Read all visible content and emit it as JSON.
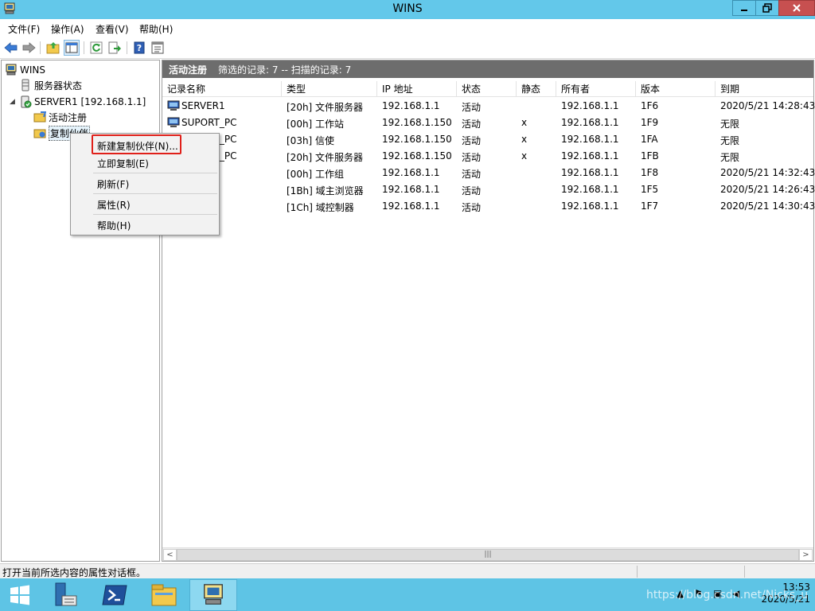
{
  "window": {
    "title": "WINS"
  },
  "menu": [
    "文件(F)",
    "操作(A)",
    "查看(V)",
    "帮助(H)"
  ],
  "tree": {
    "root": "WINS",
    "server_status": "服务器状态",
    "server": "SERVER1 [192.168.1.1]",
    "active_registrations": "活动注册",
    "replication_partners": "复制伙伴"
  },
  "pane_header": {
    "title": "活动注册",
    "summary": "筛选的记录: 7 -- 扫描的记录: 7"
  },
  "table": {
    "columns": [
      "记录名称",
      "类型",
      "IP 地址",
      "状态",
      "静态",
      "所有者",
      "版本",
      "到期"
    ],
    "rows": [
      [
        "SERVER1",
        "[20h] 文件服务器",
        "192.168.1.1",
        "活动",
        "",
        "192.168.1.1",
        "1F6",
        "2020/5/21 14:28:43"
      ],
      [
        "SUPORT_PC",
        "[00h] 工作站",
        "192.168.1.150",
        "活动",
        "x",
        "192.168.1.1",
        "1F9",
        "无限"
      ],
      [
        "SUPORT_PC",
        "[03h] 信使",
        "192.168.1.150",
        "活动",
        "x",
        "192.168.1.1",
        "1FA",
        "无限"
      ],
      [
        "SUPORT_PC",
        "[20h] 文件服务器",
        "192.168.1.150",
        "活动",
        "x",
        "192.168.1.1",
        "1FB",
        "无限"
      ],
      [
        "",
        "[00h] 工作组",
        "192.168.1.1",
        "活动",
        "",
        "192.168.1.1",
        "1F8",
        "2020/5/21 14:32:43"
      ],
      [
        "",
        "[1Bh] 域主浏览器",
        "192.168.1.1",
        "活动",
        "",
        "192.168.1.1",
        "1F5",
        "2020/5/21 14:26:43"
      ],
      [
        "",
        "[1Ch] 域控制器",
        "192.168.1.1",
        "活动",
        "",
        "192.168.1.1",
        "1F7",
        "2020/5/21 14:30:43"
      ]
    ]
  },
  "context_menu": {
    "new_partner": "新建复制伙伴(N)...",
    "replicate_now": "立即复制(E)",
    "refresh": "刷新(F)",
    "properties": "属性(R)",
    "help": "帮助(H)"
  },
  "status_text": "打开当前所选内容的属性对话框。",
  "taskbar": {
    "time": "13:53",
    "date": "2020/5/21"
  },
  "watermark": "https://blog.csdn.net/Nicks_u",
  "colors": {
    "title_bar": "#63c8ea",
    "taskbar": "#5ec4e5",
    "pane_header": "#6d6d6d",
    "highlight_border": "#e0201a",
    "close_button": "#c75050"
  },
  "icons": [
    "wins-app-icon",
    "back-arrow-icon",
    "forward-arrow-icon",
    "up-folder-icon",
    "show-hide-tree-icon",
    "refresh-icon",
    "export-list-icon",
    "help-icon",
    "properties-icon",
    "server-icon",
    "database-icon",
    "folder-icon",
    "computer-icon",
    "windows-start-icon",
    "server-manager-icon",
    "powershell-icon",
    "file-explorer-icon"
  ]
}
